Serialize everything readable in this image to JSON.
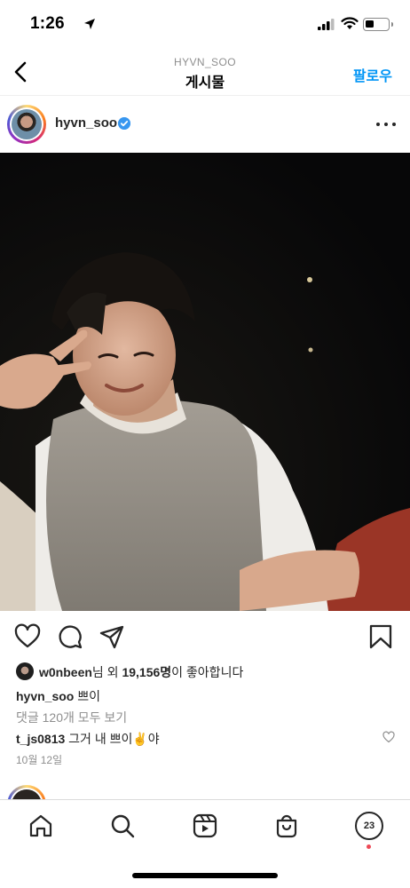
{
  "status_bar": {
    "time": "1:26"
  },
  "header": {
    "subtitle": "HYVN_SOO",
    "title": "게시물",
    "follow_label": "팔로우"
  },
  "post": {
    "username": "hyvn_soo",
    "likes": {
      "liked_by": "w0nbeen",
      "text_after_name": "님 외 ",
      "count": "19,156명",
      "text_end": "이 좋아합니다"
    },
    "caption": {
      "username": "hyvn_soo",
      "text": " 쁘이"
    },
    "view_comments": "댓글 120개 모두 보기",
    "comment": {
      "username": "t_js0813",
      "text": " 그거 내 쁘이✌️야"
    },
    "date": "10월 12일"
  },
  "tab_bar": {
    "items": [
      "home-icon",
      "search-icon",
      "reels-icon",
      "shop-icon",
      "profile"
    ],
    "profile_label": "23"
  },
  "colors": {
    "accent": "#0095f6",
    "verified": "#3897f0",
    "notification": "#ed4956"
  }
}
